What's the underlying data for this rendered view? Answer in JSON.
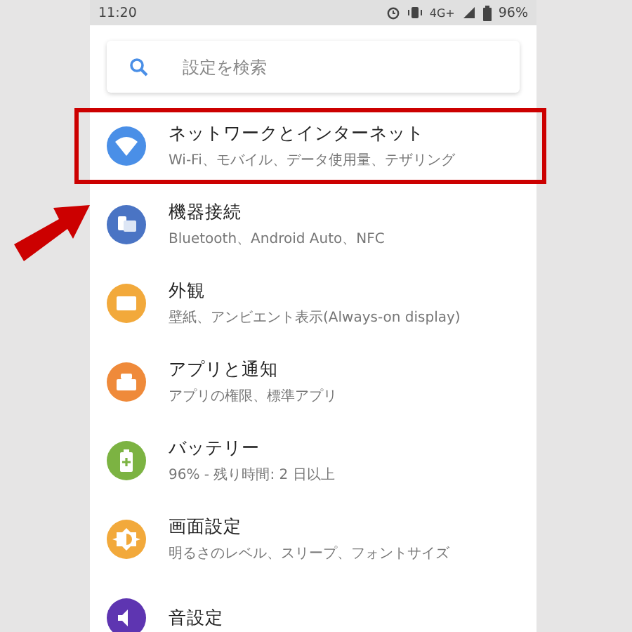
{
  "status_bar": {
    "time": "11:20",
    "network": "4G+",
    "battery": "96%"
  },
  "search": {
    "placeholder": "設定を検索"
  },
  "items": [
    {
      "kind": "wifi",
      "color": "#4a8fe7",
      "title": "ネットワークとインターネット",
      "subtitle": "Wi-Fi、モバイル、データ使用量、テザリング",
      "highlighted": true
    },
    {
      "kind": "devices",
      "color": "#4a74c4",
      "title": "機器接続",
      "subtitle": "Bluetooth、Android Auto、NFC",
      "highlighted": false
    },
    {
      "kind": "appearance",
      "color": "#f2a93b",
      "title": "外観",
      "subtitle": "壁紙、アンビエント表示(Always-on display)",
      "highlighted": false
    },
    {
      "kind": "apps",
      "color": "#ef8a3a",
      "title": "アプリと通知",
      "subtitle": "アプリの権限、標準アプリ",
      "highlighted": false
    },
    {
      "kind": "battery",
      "color": "#7cb342",
      "title": "バッテリー",
      "subtitle": "96% - 残り時間: 2 日以上",
      "highlighted": false
    },
    {
      "kind": "display",
      "color": "#f2a93b",
      "title": "画面設定",
      "subtitle": "明るさのレベル、スリープ、フォントサイズ",
      "highlighted": false
    },
    {
      "kind": "sound",
      "color": "#5e35b1",
      "title": "音設定",
      "highlighted": false
    }
  ]
}
